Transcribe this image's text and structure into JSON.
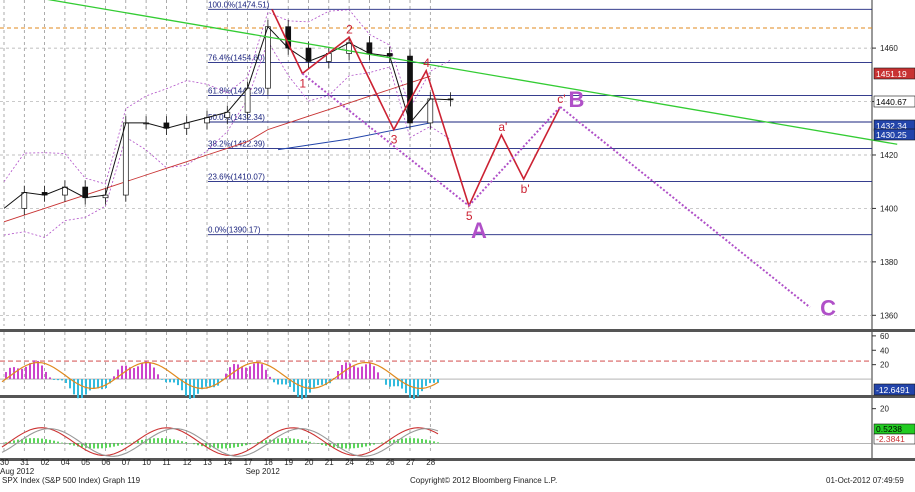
{
  "chart_data": {
    "type": "line",
    "footer": {
      "left": "SPX Index (S&P 500 Index) Graph 119",
      "center": "Copyright© 2012 Bloomberg Finance L.P.",
      "right": "01-Oct-2012 07:49:59"
    },
    "x_ticks": {
      "days": [
        "30",
        "31",
        "02",
        "04",
        "05",
        "06",
        "07",
        "10",
        "11",
        "12",
        "13",
        "14",
        "17",
        "18",
        "19",
        "20",
        "21",
        "24",
        "25",
        "26",
        "27",
        "28"
      ],
      "months": [
        "Aug 2012",
        "Sep 2012"
      ]
    },
    "price_axis": {
      "ticks": [
        1360,
        1380,
        1400,
        1420,
        1440,
        1460
      ],
      "ylim": [
        1356,
        1478
      ],
      "price_labels": [
        {
          "text": "1451.19",
          "value": 1451.19,
          "color": "#c83232"
        },
        {
          "text": "1440.67",
          "value": 1440.67,
          "color": "#000000"
        },
        {
          "text": "1432.34",
          "value": 1432.34,
          "color": "#2244aa"
        },
        {
          "text": "1430.25",
          "value": 1430.25,
          "color": "#2244aa"
        }
      ]
    },
    "fibonacci": [
      {
        "label": "100.0%(1474.51)",
        "value": 1474.51
      },
      {
        "label": "76.4%(1454.60)",
        "value": 1454.6
      },
      {
        "label": "61.8%(1442.29)",
        "value": 1442.29
      },
      {
        "label": "50.0%(1432.34)",
        "value": 1432.34
      },
      {
        "label": "38.2%(1422.39)",
        "value": 1422.39
      },
      {
        "label": "23.6%(1410.07)",
        "value": 1410.07
      },
      {
        "label": "0.0%(1390.17)",
        "value": 1390.17
      }
    ],
    "orange_level": 1467.5,
    "prices": {
      "x": [
        0,
        1,
        2,
        3,
        4,
        5,
        6,
        7,
        8,
        9,
        10,
        11,
        12,
        13,
        14,
        15,
        16,
        17,
        18,
        19,
        20,
        21,
        22
      ],
      "close": [
        1400,
        1406,
        1405,
        1408,
        1404,
        1405,
        1432,
        1432,
        1430,
        1432,
        1434,
        1436,
        1445,
        1468,
        1460,
        1455,
        1458,
        1462,
        1458,
        1457,
        1432,
        1441,
        1440.67
      ]
    },
    "wave_points": [
      {
        "label": "1",
        "x": 14.7,
        "y": 1450.5
      },
      {
        "label": "2",
        "x": 17.0,
        "y": 1464
      },
      {
        "label": "3",
        "x": 19.2,
        "y": 1429.5
      },
      {
        "label": "4",
        "x": 20.8,
        "y": 1451.5
      },
      {
        "label": "5",
        "x": 22.9,
        "y": 1401
      },
      {
        "label": "a'",
        "x": 24.5,
        "y": 1427.5
      },
      {
        "label": "b'",
        "x": 25.6,
        "y": 1411
      },
      {
        "label": "c'",
        "x": 27.4,
        "y": 1438
      }
    ],
    "wave_letters": [
      {
        "label": "A",
        "x": 23.4,
        "y": 1392
      },
      {
        "label": "B",
        "x": 28.2,
        "y": 1441
      },
      {
        "label": "C",
        "x": 40.6,
        "y": 1363
      }
    ],
    "projection_line": {
      "from": {
        "x": 27.4,
        "y": 1438
      },
      "to": {
        "x": 39.7,
        "y": 1363
      }
    },
    "trend_line_green": {
      "from": {
        "x": 0,
        "y": 1481
      },
      "to": {
        "x": 44,
        "y": 1424
      }
    },
    "oscillator1": {
      "ticks": [
        20,
        40,
        60
      ],
      "ylim": [
        -18,
        64
      ],
      "dashed_level": 25,
      "label": "-12.6491"
    },
    "oscillator2": {
      "ticks": [
        20
      ],
      "labels": [
        {
          "text": "0.5238",
          "color": "#22cc22"
        },
        {
          "text": "-2.3841",
          "color": "#c83232"
        }
      ]
    }
  }
}
